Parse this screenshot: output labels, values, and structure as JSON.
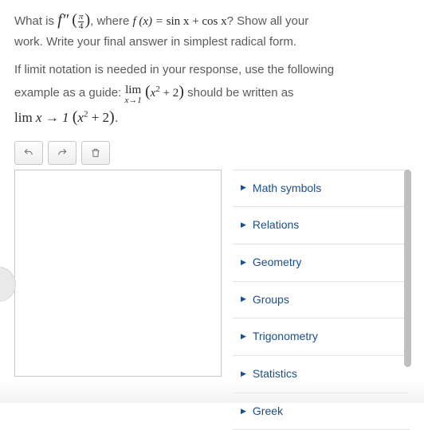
{
  "question": {
    "line1_pre": "What is ",
    "f2": "f″",
    "paren_open": "(",
    "frac_num": "π",
    "frac_den": "4",
    "paren_close": ")",
    "comma": ", ",
    "where": "where ",
    "fx": "f (x) = ",
    "sincos": "sin x + cos x",
    "q": "? Show all your",
    "line2": "work. Write your final answer in simplest radical form.",
    "line3": "If limit notation is needed in your response, use the following",
    "line4_pre": "example as a guide: ",
    "lim": "lim",
    "limsub": "x→1",
    "expr_open": "(",
    "expr_x2": "x",
    "expr_sup": "2",
    "expr_plus": " + 2",
    "expr_close": ")",
    "line4_post": " should be written as",
    "line5_lim": "lim ",
    "line5_arrow": "x → 1 ",
    "line5_expr_open": "(",
    "line5_x2": "x",
    "line5_sup": "2",
    "line5_plus": " + 2",
    "line5_close": ")",
    "period": "."
  },
  "toolbar": {
    "undo": "undo",
    "redo": "redo",
    "delete": "delete"
  },
  "editor": {
    "value": ""
  },
  "palette": {
    "items": [
      {
        "label": "Math symbols"
      },
      {
        "label": "Relations"
      },
      {
        "label": "Geometry"
      },
      {
        "label": "Groups"
      },
      {
        "label": "Trigonometry"
      },
      {
        "label": "Statistics"
      },
      {
        "label": "Greek"
      }
    ]
  }
}
